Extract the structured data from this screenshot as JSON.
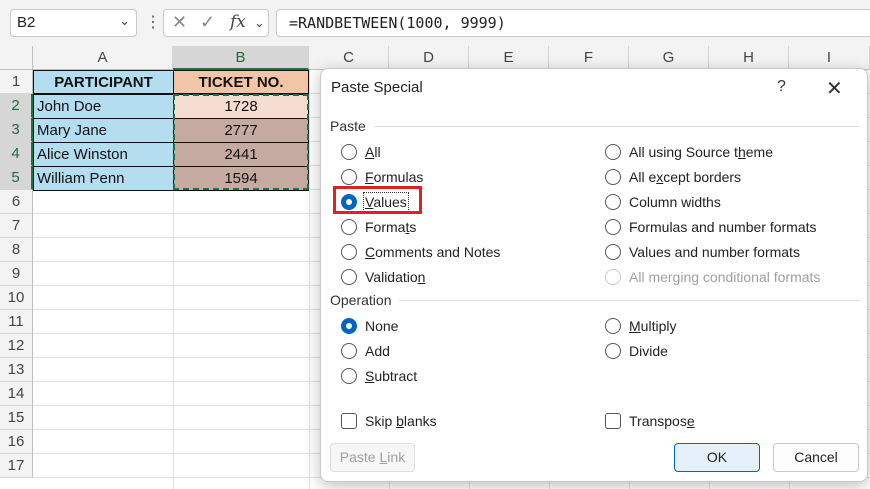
{
  "formula_bar": {
    "name_box": "B2",
    "formula": "=RANDBETWEEN(1000, 9999)",
    "fx_label": "fx"
  },
  "columns": [
    "A",
    "B",
    "C",
    "D",
    "E",
    "F",
    "G",
    "H",
    "I"
  ],
  "rows": [
    "1",
    "2",
    "3",
    "4",
    "5",
    "6",
    "7",
    "8",
    "9",
    "10",
    "11",
    "12",
    "13",
    "14",
    "15",
    "16",
    "17"
  ],
  "sheet": {
    "header": {
      "participant": "PARTICIPANT",
      "ticket": "TICKET NO."
    },
    "data": [
      {
        "name": "John Doe",
        "ticket": "1728"
      },
      {
        "name": "Mary Jane",
        "ticket": "2777"
      },
      {
        "name": "Alice Winston",
        "ticket": "2441"
      },
      {
        "name": "William Penn",
        "ticket": "1594"
      }
    ]
  },
  "dialog": {
    "title": "Paste Special",
    "help": "?",
    "close": "✕",
    "paste_label": "Paste",
    "paste_left": [
      "All",
      "Formulas",
      "Values",
      "Formats",
      "Comments and Notes",
      "Validation"
    ],
    "paste_right": [
      "All using Source theme",
      "All except borders",
      "Column widths",
      "Formulas and number formats",
      "Values and number formats",
      "All merging conditional formats"
    ],
    "operation_label": "Operation",
    "operation_left": [
      "None",
      "Add",
      "Subtract"
    ],
    "operation_right": [
      "Multiply",
      "Divide"
    ],
    "skip_blanks": "Skip blanks",
    "transpose": "Transpose",
    "paste_link": "Paste Link",
    "ok": "OK",
    "cancel": "Cancel"
  },
  "colors": {
    "accent": "#0067c0",
    "highlight": "#e01f26",
    "excel_green": "#1e7145"
  }
}
